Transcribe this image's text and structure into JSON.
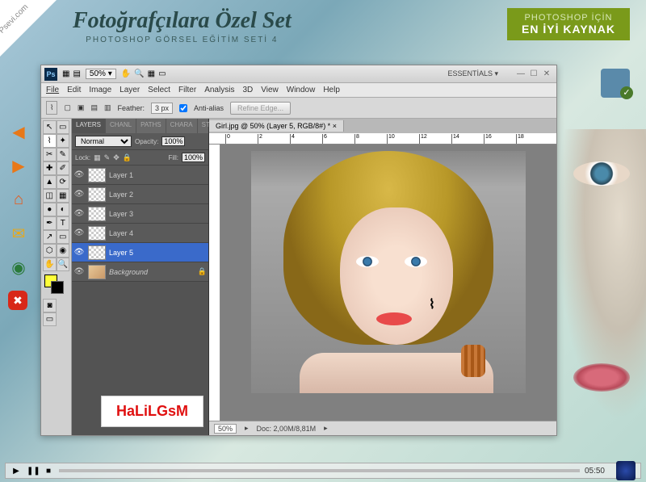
{
  "corner": "Psevi.com",
  "header": {
    "main": "Fotoğrafçılara Özel Set",
    "sub": "PHOTOSHOP GÖRSEL EĞİTİM SETİ 4",
    "badge1": "PHOTOSHOP İÇİN",
    "badge2": "EN İYİ KAYNAK"
  },
  "ps": {
    "workspace": "ESSENTİALS ▾",
    "zoom_combo": "50%  ▾",
    "menus": [
      "File",
      "Edit",
      "Image",
      "Layer",
      "Select",
      "Filter",
      "Analysis",
      "3D",
      "View",
      "Window",
      "Help"
    ],
    "options": {
      "feather_label": "Feather:",
      "feather_val": "3 px",
      "aa_label": "Anti-alias",
      "refine": "Refine Edge..."
    },
    "panel_tabs": [
      "LAYERS",
      "CHANL",
      "PATHS",
      "CHARA",
      "STYLE"
    ],
    "blend": "Normal",
    "opacity_label": "Opacity:",
    "opacity_val": "100%",
    "lock_label": "Lock:",
    "fill_label": "Fill:",
    "fill_val": "100%",
    "layers": [
      {
        "name": "Layer 1"
      },
      {
        "name": "Layer 2"
      },
      {
        "name": "Layer 3"
      },
      {
        "name": "Layer 4"
      },
      {
        "name": "Layer 5"
      },
      {
        "name": "Background"
      }
    ],
    "doc_tab": "Girl.jpg @ 50% (Layer 5, RGB/8#) * ×",
    "status_zoom": "50%",
    "status_doc": "Doc: 2,00M/8,81M"
  },
  "watermark": "HaLiLGsM",
  "player": {
    "time": "05:50"
  }
}
